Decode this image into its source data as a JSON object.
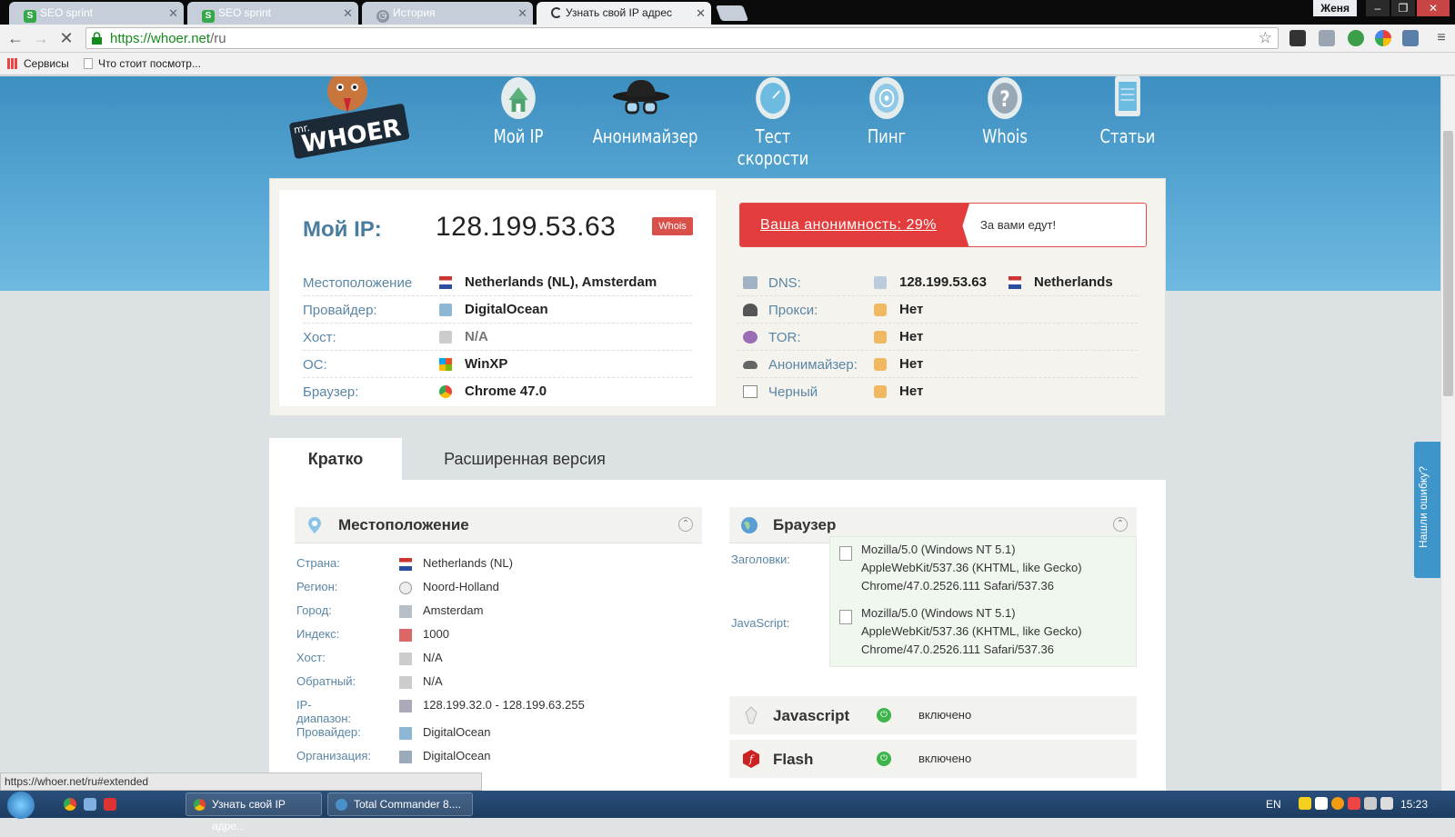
{
  "browser": {
    "tabs": [
      {
        "title": "SEO sprint",
        "icon": "seo-sprint-icon"
      },
      {
        "title": "SEO sprint",
        "icon": "seo-sprint-icon"
      },
      {
        "title": "История",
        "icon": "history-icon"
      },
      {
        "title": "Узнать свой IP адрес",
        "icon": "loading-icon"
      }
    ],
    "user": "Женя",
    "url_main": "https://whoer.net",
    "url_path": "/ru",
    "bookmarks": [
      "Сервисы",
      "Что стоит посмотр..."
    ],
    "status_url": "https://whoer.net/ru#extended"
  },
  "site": {
    "logo_text": "WHOER",
    "logo_prefix": "mr.",
    "nav": [
      "Мой IP",
      "Анонимайзер",
      "Тест скорости",
      "Пинг",
      "Whois",
      "Статьи"
    ]
  },
  "ip": {
    "label": "Мой IP:",
    "value": "128.199.53.63",
    "whois": "Whois",
    "rows": [
      {
        "label": "Местоположение",
        "value": "Netherlands (NL), Amsterdam",
        "icon": "flag-nl-icon"
      },
      {
        "label": "Провайдер:",
        "value": "DigitalOcean",
        "icon": "provider-icon"
      },
      {
        "label": "Хост:",
        "value": "N/A",
        "icon": "host-icon"
      },
      {
        "label": "ОС:",
        "value": "WinXP",
        "icon": "windows-icon"
      },
      {
        "label": "Браузер:",
        "value": "Chrome 47.0",
        "icon": "chrome-icon"
      }
    ]
  },
  "anonymity": {
    "text": "Ваша анонимность: 29%",
    "message": "За вами едут!",
    "percent": 29
  },
  "checks": [
    {
      "label": "DNS:",
      "value": "128.199.53.63",
      "extra": "Netherlands",
      "icon": "dns-icon"
    },
    {
      "label": "Прокси:",
      "value": "Нет",
      "icon": "proxy-icon"
    },
    {
      "label": "TOR:",
      "value": "Нет",
      "icon": "tor-icon"
    },
    {
      "label": "Анонимайзер:",
      "value": "Нет",
      "icon": "anonymizer-icon"
    },
    {
      "label": "Черный",
      "value": "Нет",
      "icon": "blacklist-icon"
    }
  ],
  "tabs": {
    "short": "Кратко",
    "extended": "Расширенная версия"
  },
  "location": {
    "title": "Местоположение",
    "rows": [
      {
        "label": "Страна:",
        "value": "Netherlands (NL)",
        "icon": "flag-nl-icon"
      },
      {
        "label": "Регион:",
        "value": "Noord-Holland",
        "icon": "compass-icon"
      },
      {
        "label": "Город:",
        "value": "Amsterdam",
        "icon": "city-icon"
      },
      {
        "label": "Индекс:",
        "value": "1000",
        "icon": "mailbox-icon"
      },
      {
        "label": "Хост:",
        "value": "N/A",
        "icon": "host-icon"
      },
      {
        "label": "Обратный:",
        "value": "N/A",
        "icon": "host-icon"
      },
      {
        "label": "IP-диапазон:",
        "value": "128.199.32.0 - 128.199.63.255",
        "icon": "range-icon"
      },
      {
        "label": "Провайдер:",
        "value": "DigitalOcean",
        "icon": "provider-icon"
      },
      {
        "label": "Организация:",
        "value": "DigitalOcean",
        "icon": "organization-icon"
      }
    ]
  },
  "browser_section": {
    "title": "Браузер",
    "headers_label": "Заголовки:",
    "js_label": "JavaScript:",
    "headers_ua": [
      "Mozilla/5.0 (Windows NT 5.1)",
      "AppleWebKit/537.36 (KHTML, like Gecko)",
      "Chrome/47.0.2526.111 Safari/537.36"
    ],
    "js_ua": [
      "Mozilla/5.0 (Windows NT 5.1)",
      "AppleWebKit/537.36 (KHTML, like Gecko)",
      "Chrome/47.0.2526.111 Safari/537.36"
    ],
    "features": [
      {
        "title": "Javascript",
        "value": "включено"
      },
      {
        "title": "Flash",
        "value": "включено"
      }
    ]
  },
  "report": "Нашли ошибку?",
  "taskbar": {
    "items": [
      "Узнать свой IP адре...",
      "Total Commander 8...."
    ],
    "lang": "EN",
    "time": "15:23"
  }
}
